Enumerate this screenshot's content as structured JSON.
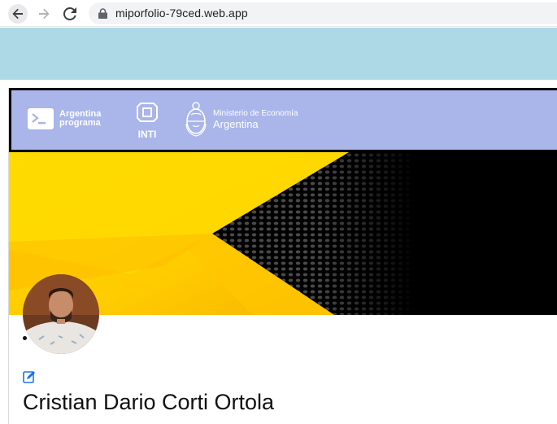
{
  "browser": {
    "url": "miporfolio-79ced.web.app",
    "icons": [
      "back-arrow-icon",
      "forward-arrow-icon",
      "reload-icon",
      "lock-icon"
    ]
  },
  "header": {
    "argentina_programa": {
      "line1": "Argentina",
      "line2": "programa"
    },
    "inti": "INTI",
    "ministerio": {
      "line1": "Ministerio de Economía",
      "line2": "Argentina"
    }
  },
  "profile": {
    "name": "Cristian Dario Corti Ortola",
    "edit_icon": "edit-pencil-icon"
  },
  "colors": {
    "top_band": "#add8e6",
    "header_bg": "#aab5ea",
    "banner_yellow": "#ffd400",
    "banner_black": "#000000",
    "edit_blue": "#1a73e8"
  }
}
